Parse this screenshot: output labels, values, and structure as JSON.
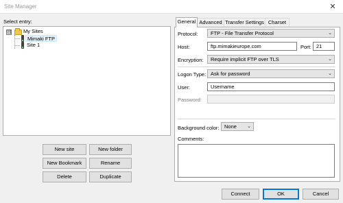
{
  "window": {
    "title": "Site Manager",
    "close_glyph": "✕"
  },
  "select_entry_label": "Select entry:",
  "tree": {
    "root": {
      "label": "My Sites",
      "expander": "⊟",
      "icon": "folder-icon"
    },
    "items": [
      {
        "label": "Mimaki FTP",
        "icon": "server-icon",
        "selected": true
      },
      {
        "label": "Site 1",
        "icon": "server-icon",
        "selected": false
      }
    ]
  },
  "buttons": {
    "new_site": "New site",
    "new_folder": "New folder",
    "new_bookmark": "New Bookmark",
    "rename": "Rename",
    "delete": "Delete",
    "duplicate": "Duplicate",
    "connect": "Connect",
    "ok": "OK",
    "cancel": "Cancel"
  },
  "tabs": [
    "General",
    "Advanced",
    "Transfer Settings",
    "Charset"
  ],
  "general": {
    "protocol_label": "Protocol:",
    "protocol_value": "FTP - File Transfer Protocol",
    "host_label": "Host:",
    "host_value": "ftp.mimakieurope.com",
    "port_label": "Port:",
    "port_value": "21",
    "encryption_label": "Encryption:",
    "encryption_value": "Require implicit FTP over TLS",
    "logon_type_label": "Logon Type:",
    "logon_type_value": "Ask for password",
    "user_label": "User:",
    "user_value": "Username",
    "password_label": "Password:",
    "password_value": "",
    "bgcolor_label": "Background color:",
    "bgcolor_value": "None",
    "comments_label": "Comments:",
    "comments_value": ""
  }
}
